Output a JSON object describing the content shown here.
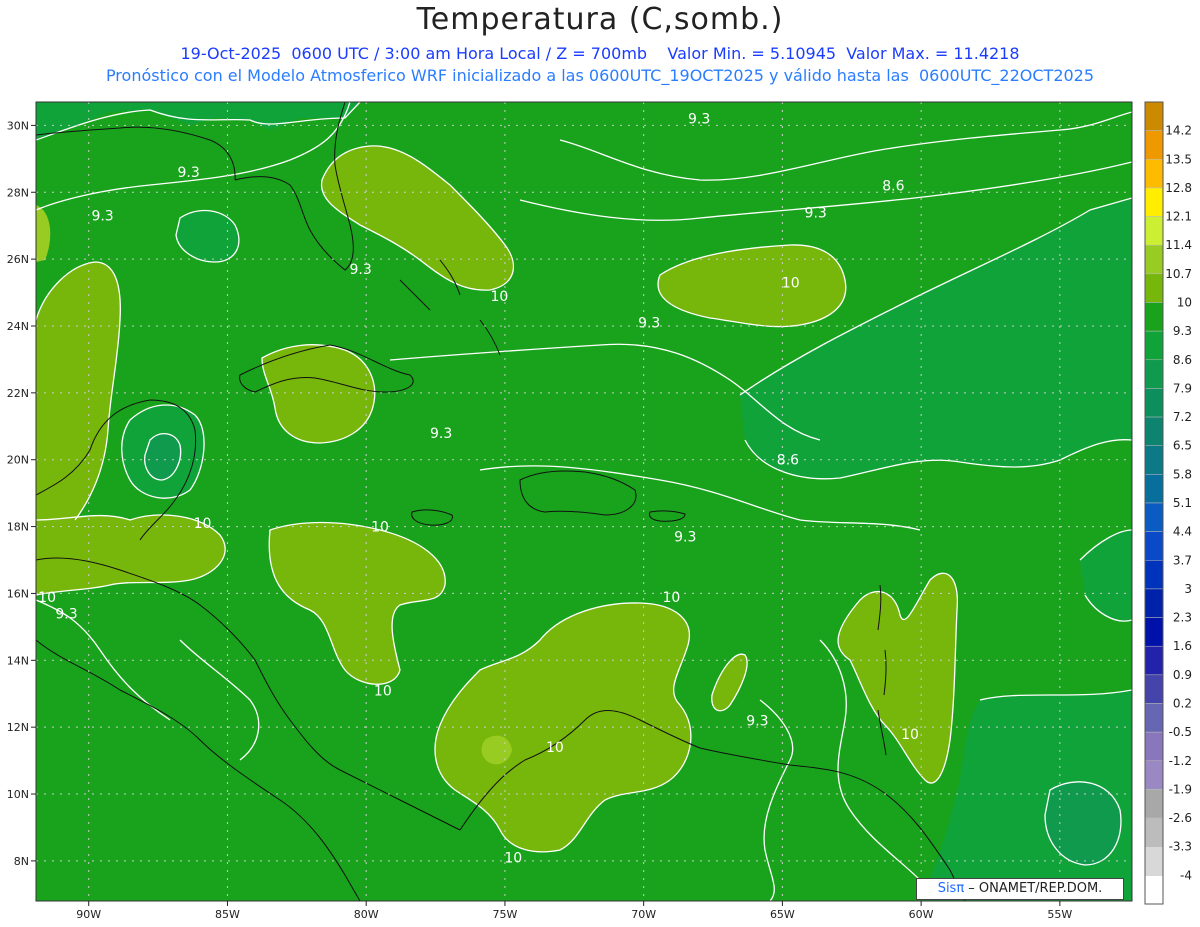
{
  "header": {
    "title": "Temperatura (C,somb.)",
    "subtitle1": "19-Oct-2025  0600 UTC / 3:00 am Hora Local / Z = 700mb    Valor Min. = 5.10945  Valor Max. = 11.4218",
    "subtitle2": "Pronóstico con el Modelo Atmosferico WRF inicializado a las 0600UTC_19OCT2025 y válido hasta las  0600UTC_22OCT2025"
  },
  "map": {
    "lat_range": [
      6.8,
      30.7
    ],
    "lon_range": [
      -91.9,
      -52.4
    ],
    "lat_ticks": [
      {
        "value": 30,
        "label": "30N"
      },
      {
        "value": 28,
        "label": "28N"
      },
      {
        "value": 26,
        "label": "26N"
      },
      {
        "value": 24,
        "label": "24N"
      },
      {
        "value": 22,
        "label": "22N"
      },
      {
        "value": 20,
        "label": "20N"
      },
      {
        "value": 18,
        "label": "18N"
      },
      {
        "value": 16,
        "label": "16N"
      },
      {
        "value": 14,
        "label": "14N"
      },
      {
        "value": 12,
        "label": "12N"
      },
      {
        "value": 10,
        "label": "10N"
      },
      {
        "value": 8,
        "label": "8N"
      }
    ],
    "lon_ticks": [
      {
        "value": -90,
        "label": "90W"
      },
      {
        "value": -85,
        "label": "85W"
      },
      {
        "value": -80,
        "label": "80W"
      },
      {
        "value": -75,
        "label": "75W"
      },
      {
        "value": -70,
        "label": "70W"
      },
      {
        "value": -65,
        "label": "65W"
      },
      {
        "value": -60,
        "label": "60W"
      },
      {
        "value": -55,
        "label": "55W"
      }
    ],
    "background_color": "#19a31d",
    "contour_labels": [
      {
        "text": "9.3",
        "lon": -68.0,
        "lat": 30.2
      },
      {
        "text": "9.3",
        "lon": -86.4,
        "lat": 28.6
      },
      {
        "text": "8.6",
        "lon": -61.0,
        "lat": 28.2
      },
      {
        "text": "9.3",
        "lon": -89.5,
        "lat": 27.3
      },
      {
        "text": "9.3",
        "lon": -63.8,
        "lat": 27.4
      },
      {
        "text": "10",
        "lon": -64.7,
        "lat": 25.3
      },
      {
        "text": "9.3",
        "lon": -80.2,
        "lat": 25.7
      },
      {
        "text": "10",
        "lon": -75.2,
        "lat": 24.9
      },
      {
        "text": "9.3",
        "lon": -69.8,
        "lat": 24.1
      },
      {
        "text": "9.3",
        "lon": -77.3,
        "lat": 20.8
      },
      {
        "text": "8.6",
        "lon": -64.8,
        "lat": 20.0
      },
      {
        "text": "10",
        "lon": -85.9,
        "lat": 18.1
      },
      {
        "text": "10",
        "lon": -79.5,
        "lat": 18.0
      },
      {
        "text": "9.3",
        "lon": -68.5,
        "lat": 17.7
      },
      {
        "text": "10",
        "lon": -91.5,
        "lat": 15.9
      },
      {
        "text": "10",
        "lon": -69.0,
        "lat": 15.9
      },
      {
        "text": "9.3",
        "lon": -90.8,
        "lat": 15.4
      },
      {
        "text": "10",
        "lon": -79.4,
        "lat": 13.1
      },
      {
        "text": "9.3",
        "lon": -65.9,
        "lat": 12.2
      },
      {
        "text": "10",
        "lon": -73.2,
        "lat": 11.4
      },
      {
        "text": "10",
        "lon": -60.4,
        "lat": 11.8
      },
      {
        "text": "10",
        "lon": -74.7,
        "lat": 8.1
      }
    ]
  },
  "colorbar": {
    "levels": [
      {
        "label": "14.2",
        "color": "#cc8a00"
      },
      {
        "label": "13.5",
        "color": "#ee9900"
      },
      {
        "label": "12.8",
        "color": "#ffbb00"
      },
      {
        "label": "12.1",
        "color": "#ffee00"
      },
      {
        "label": "11.4",
        "color": "#ccee33"
      },
      {
        "label": "10.7",
        "color": "#99cc22"
      },
      {
        "label": "10",
        "color": "#77b60a"
      },
      {
        "label": "9.3",
        "color": "#19a31d"
      },
      {
        "label": "8.6",
        "color": "#10a33a"
      },
      {
        "label": "7.9",
        "color": "#0f9a4d"
      },
      {
        "label": "7.2",
        "color": "#0d8f5d"
      },
      {
        "label": "6.5",
        "color": "#0c8470"
      },
      {
        "label": "5.8",
        "color": "#0b7a86"
      },
      {
        "label": "5.1",
        "color": "#086f9d"
      },
      {
        "label": "4.4",
        "color": "#0a5cc2"
      },
      {
        "label": "3.7",
        "color": "#0a49c8"
      },
      {
        "label": "3",
        "color": "#0033bb"
      },
      {
        "label": "2.3",
        "color": "#0022aa"
      },
      {
        "label": "1.6",
        "color": "#0011aa"
      },
      {
        "label": "0.9",
        "color": "#2222aa"
      },
      {
        "label": "0.2",
        "color": "#4444aa"
      },
      {
        "label": "-0.5",
        "color": "#6666b3"
      },
      {
        "label": "-1.2",
        "color": "#8877bb"
      },
      {
        "label": "-1.9",
        "color": "#9988c2"
      },
      {
        "label": "-2.6",
        "color": "#a8a8a8"
      },
      {
        "label": "-3.3",
        "color": "#bcbcbc"
      },
      {
        "label": "-4",
        "color": "#d8d8d8"
      },
      {
        "label": "",
        "color": "#ffffff"
      }
    ]
  },
  "credit": {
    "brand": "Sisπ",
    "text": " – ONAMET/REP.DOM."
  }
}
